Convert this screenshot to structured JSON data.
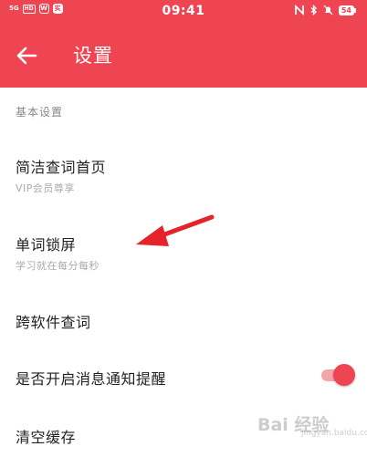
{
  "status_bar": {
    "network": "5G",
    "hd": "HD",
    "app_icon_1": "W",
    "app_icon_2": "实",
    "time": "09:41",
    "battery": "54"
  },
  "app_bar": {
    "title": "设置",
    "back_icon": "arrow-left-icon"
  },
  "settings": {
    "section_header": "基本设置",
    "items": [
      {
        "title": "简洁查词首页",
        "subtitle": "VIP会员尊享"
      },
      {
        "title": "单词锁屏",
        "subtitle": "学习就在每分每秒"
      },
      {
        "title": "跨软件查词"
      },
      {
        "title": "是否开启消息通知提醒",
        "toggle_on": true
      },
      {
        "title": "清空缓存"
      }
    ]
  },
  "watermark": {
    "brand": "Bai 经验",
    "domain": "jingyan.baidu.com"
  },
  "colors": {
    "accent": "#ef4452",
    "annotation": "#e5232b"
  }
}
